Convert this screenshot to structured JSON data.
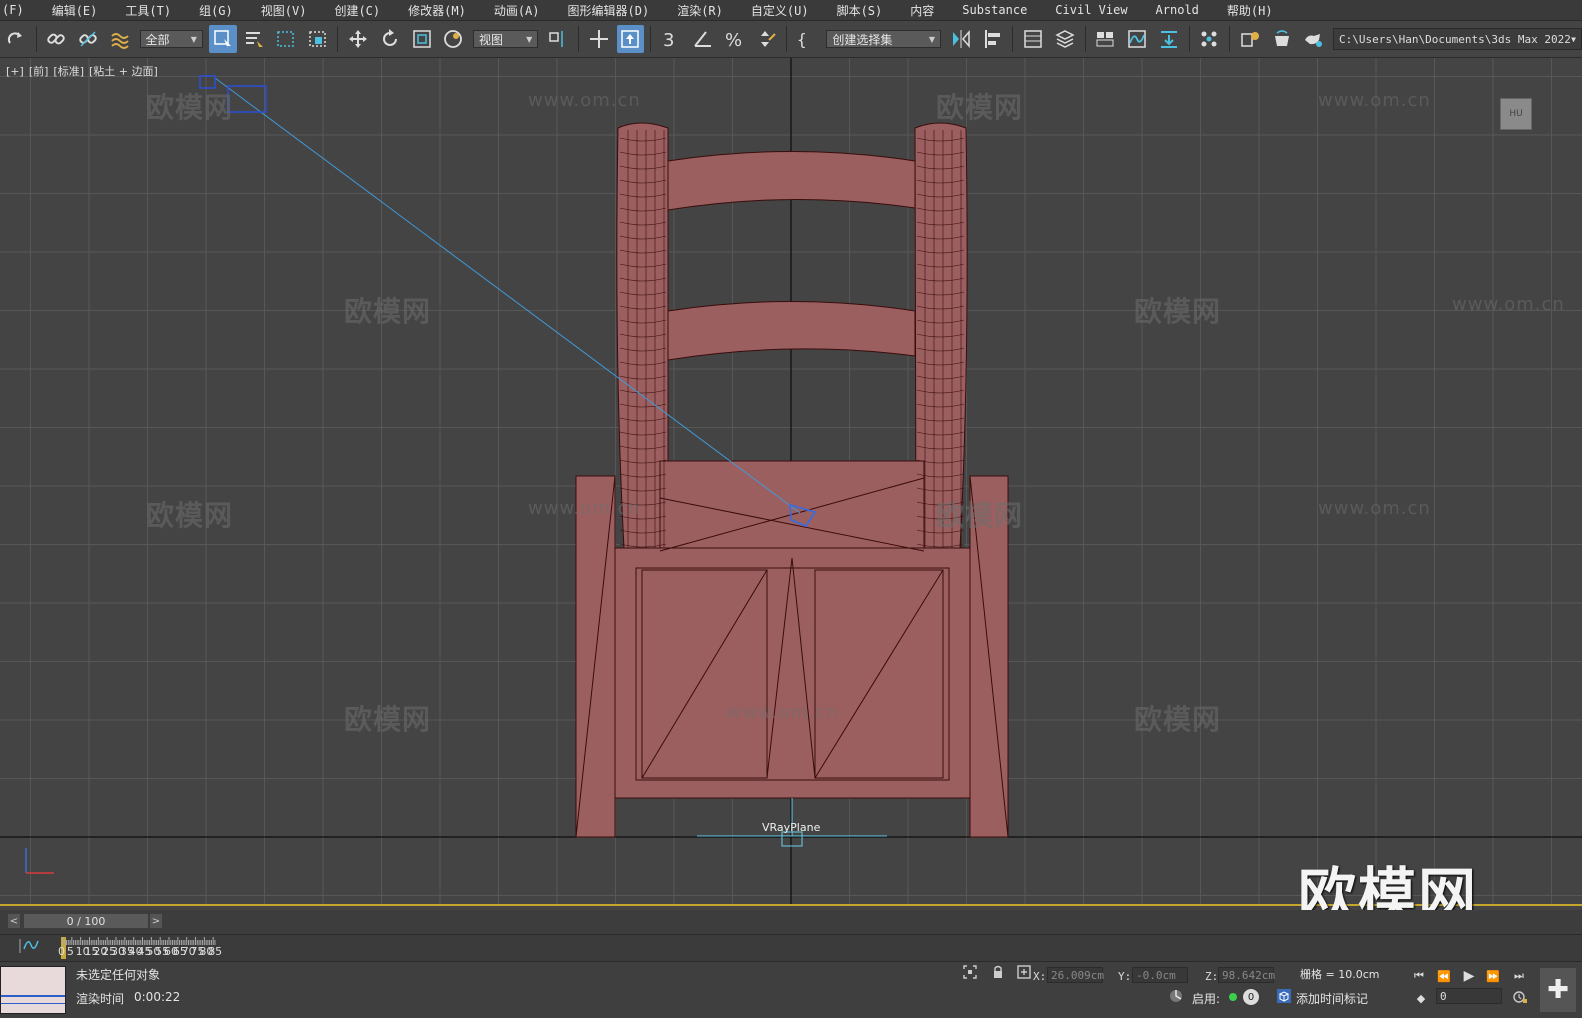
{
  "menu": [
    "(F)",
    "编辑(E)",
    "工具(T)",
    "组(G)",
    "视图(V)",
    "创建(C)",
    "修改器(M)",
    "动画(A)",
    "图形编辑器(D)",
    "渲染(R)",
    "自定义(U)",
    "脚本(S)",
    "内容",
    "Substance",
    "Civil View",
    "Arnold",
    "帮助(H)"
  ],
  "toolbar": {
    "filter_dropdown": "全部",
    "refcoord_dropdown": "视图",
    "selection_set_dropdown": "创建选择集",
    "project_path": "C:\\Users\\Han\\Documents\\3ds Max 2022"
  },
  "viewport": {
    "label": [
      "[+]",
      "[前]",
      "[标准]",
      "[粘土 + 边面]"
    ],
    "object_label": "VRayPlane",
    "navcube_text": "HU",
    "watermark_text": "欧模网",
    "watermark_url": "www.om.cn",
    "logo": "欧模网",
    "colors": {
      "chair_fill": "#9c5f60",
      "chair_wire": "#3a0c0c",
      "grid": "#575757",
      "selection_blue": "#3f9ad8"
    }
  },
  "timeslider": {
    "label": "0 / 100"
  },
  "trackbar": {
    "ticks": [
      "0",
      "5",
      "10",
      "15",
      "20",
      "25",
      "30",
      "35",
      "40",
      "45",
      "50",
      "55",
      "60",
      "65",
      "70",
      "75",
      "80",
      "85"
    ]
  },
  "status": {
    "selection_text": "未选定任何对象",
    "render_time_label": "渲染时间",
    "render_time_value": "0:00:22",
    "x_label": "X:",
    "x_value": "26.009cm",
    "y_label": "Y:",
    "y_value": "-0.0cm",
    "z_label": "Z:",
    "z_value": "98.642cm",
    "grid_label": "栅格 = 10.0cm",
    "enable_label": "启用:",
    "enable_count": "0",
    "add_time_tag": "添加时间标记",
    "frame_value": "0"
  }
}
